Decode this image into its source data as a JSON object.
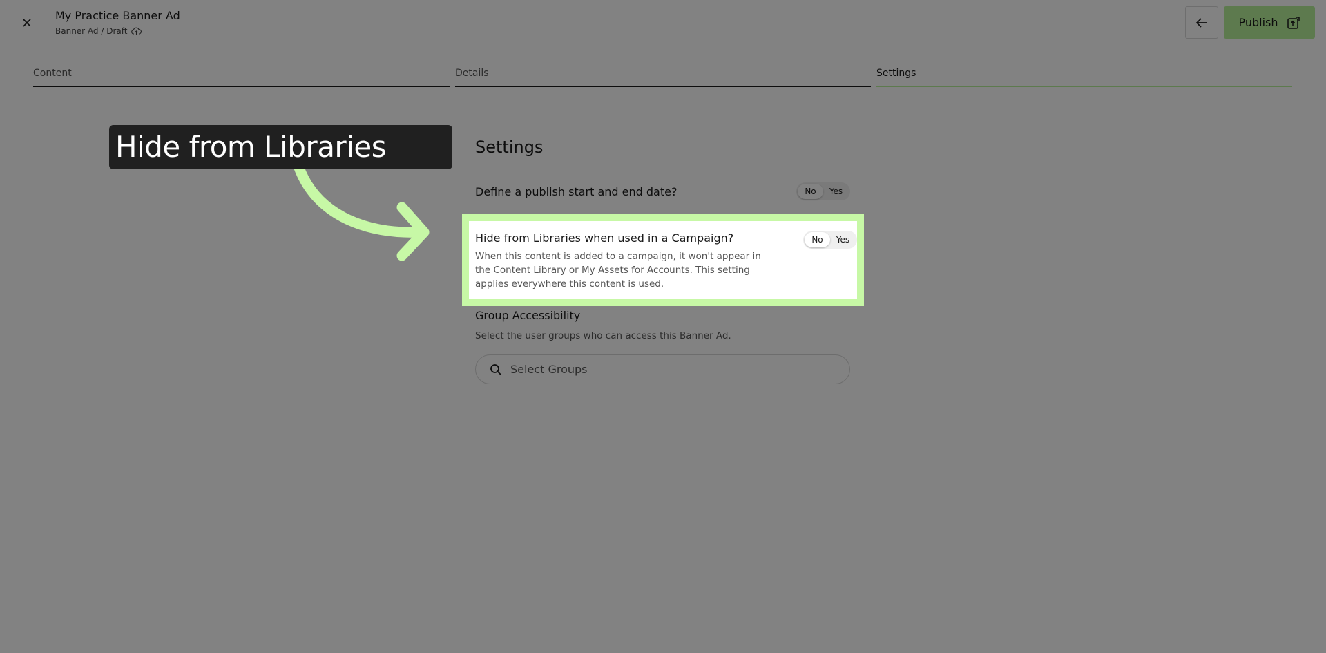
{
  "header": {
    "title": "My Practice Banner Ad",
    "subtitle": "Banner Ad / Draft",
    "publish_label": "Publish"
  },
  "tabs": [
    {
      "label": "Content",
      "state": "done"
    },
    {
      "label": "Details",
      "state": "done"
    },
    {
      "label": "Settings",
      "state": "active"
    }
  ],
  "settings": {
    "heading": "Settings",
    "publish_dates": {
      "label": "Define a publish start and end date?",
      "no": "No",
      "yes": "Yes",
      "selected": "No"
    },
    "hide_libraries": {
      "label": "Hide from Libraries when used in a Campaign?",
      "description": "When this content is added to a campaign, it won't appear in the Content Library or My Assets for Accounts. This setting applies everywhere this content is used.",
      "no": "No",
      "yes": "Yes",
      "selected": "No"
    },
    "group_access": {
      "label": "Group Accessibility",
      "description": "Select the user groups who can access this Banner Ad.",
      "search_placeholder": "Select Groups"
    }
  },
  "annotation": {
    "callout_text": "Hide from Libraries"
  },
  "colors": {
    "accent": "#b7ef9a",
    "highlight": "#c7f8a6",
    "callout_bg": "#202020"
  },
  "icons": [
    "close-icon",
    "cloud-upload-icon",
    "arrow-left-icon",
    "publish-icon",
    "search-icon"
  ]
}
